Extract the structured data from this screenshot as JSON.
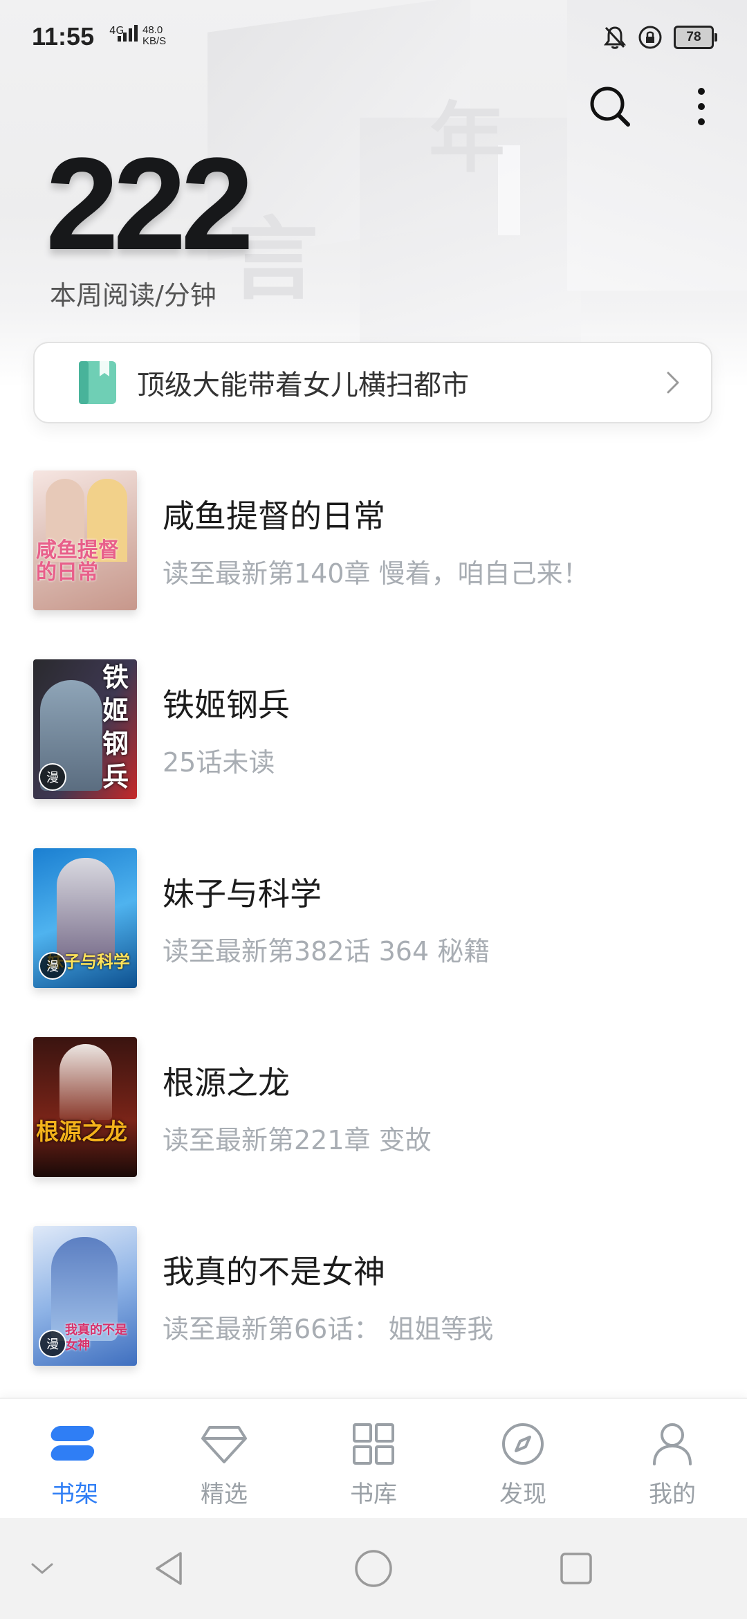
{
  "status_bar": {
    "time": "11:55",
    "network_type": "4G",
    "network_speed_value": "48.0",
    "network_speed_unit": "KB/S",
    "battery_level": "78"
  },
  "header": {
    "weekly_reading_minutes": "222",
    "weekly_label": "本周阅读/分钟",
    "decor_chars": [
      "言",
      "年"
    ]
  },
  "notice": {
    "text": "顶级大能带着女儿横扫都市"
  },
  "books": [
    {
      "title": "咸鱼提督的日常",
      "progress": "读至最新第140章 慢着，咱自己来！",
      "cover_text": "咸鱼提督的日常",
      "cover_colors": [
        "#f3e1dc",
        "#d9b7ae",
        "#c99a8f"
      ],
      "cover_text_color": "#e85f8a"
    },
    {
      "title": "铁姬钢兵",
      "progress": "25话未读",
      "cover_text": "铁姬钢兵",
      "cover_badge": "漫",
      "cover_colors": [
        "#2a2a2e",
        "#5a4c6a",
        "#c62828"
      ],
      "cover_text_color": "#ffffff"
    },
    {
      "title": "妹子与科学",
      "progress": "读至最新第382话 364 秘籍",
      "cover_text": "妹子与科学",
      "cover_badge": "漫",
      "cover_colors": [
        "#1b7fd1",
        "#4fb3ef",
        "#0d4f8e"
      ],
      "cover_text_color": "#ffe45a"
    },
    {
      "title": "根源之龙",
      "progress": "读至最新第221章 变故",
      "cover_text": "根源之龙",
      "cover_colors": [
        "#3a1410",
        "#7a2418",
        "#1a0a08"
      ],
      "cover_text_color": "#f4b21b"
    },
    {
      "title": "我真的不是女神",
      "progress": "读至最新第66话： 姐姐等我",
      "cover_text": "我真的不是女神",
      "cover_badge": "漫",
      "cover_colors": [
        "#cfe0f7",
        "#7aa6e0",
        "#3f6fbf"
      ],
      "cover_text_color": "#d8306a"
    }
  ],
  "bottom_nav": [
    {
      "label": "书架",
      "icon": "bookshelf-icon",
      "active": true
    },
    {
      "label": "精选",
      "icon": "diamond-icon",
      "active": false
    },
    {
      "label": "书库",
      "icon": "grid-icon",
      "active": false
    },
    {
      "label": "发现",
      "icon": "compass-icon",
      "active": false
    },
    {
      "label": "我的",
      "icon": "profile-icon",
      "active": false
    }
  ],
  "colors": {
    "accent": "#2f7ef5",
    "nav_inactive": "#9aa0a6",
    "secondary_text": "#a8adb3"
  }
}
